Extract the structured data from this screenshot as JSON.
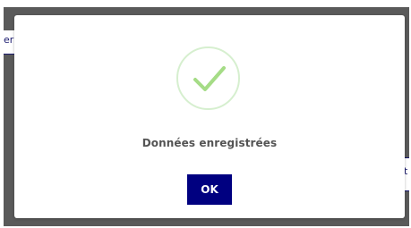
{
  "dialog": {
    "message": "Données enregistrées",
    "ok_label": "OK",
    "icon": "success-check-icon"
  },
  "background": {
    "left_fragment": "er",
    "right_fragment": "t"
  },
  "colors": {
    "overlay": "#5a5a5a",
    "button": "#000080",
    "check": "#a5dc86",
    "check_ring": "#d6efcf",
    "message_text": "#545454"
  }
}
